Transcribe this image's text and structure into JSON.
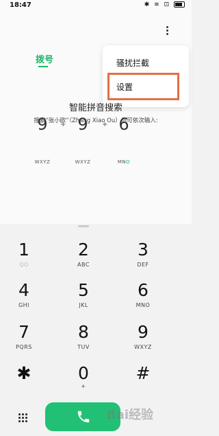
{
  "status_bar": {
    "time": "18:47",
    "icons": "✱ ≋ ⊡"
  },
  "tabs": {
    "dial": "拨号"
  },
  "menu": {
    "spam_block": "骚扰拦截",
    "settings": "设置"
  },
  "hint": {
    "title": "智能拼音搜索",
    "subtitle": "搜索“张小欧”（Zhang Xiao Ou）你可依次输入:"
  },
  "example": {
    "digits": [
      "9",
      "9",
      "6"
    ],
    "plus": "+",
    "letters": [
      "WXYZ",
      "WXYZ",
      "MN"
    ],
    "letters_highlight": "O"
  },
  "keypad": {
    "keys": [
      {
        "digit": "1",
        "letters": "QO"
      },
      {
        "digit": "2",
        "letters": "ABC"
      },
      {
        "digit": "3",
        "letters": "DEF"
      },
      {
        "digit": "4",
        "letters": "GHI"
      },
      {
        "digit": "5",
        "letters": "JKL"
      },
      {
        "digit": "6",
        "letters": "MNO"
      },
      {
        "digit": "7",
        "letters": "PQRS"
      },
      {
        "digit": "8",
        "letters": "TUV"
      },
      {
        "digit": "9",
        "letters": "WXYZ"
      },
      {
        "digit": "✱",
        "letters": ""
      },
      {
        "digit": "0",
        "letters": "+"
      },
      {
        "digit": "#",
        "letters": ""
      }
    ]
  },
  "watermark": "Bai经验",
  "colors": {
    "accent": "#1bb56a",
    "call": "#21c075",
    "highlight": "#e07040"
  }
}
